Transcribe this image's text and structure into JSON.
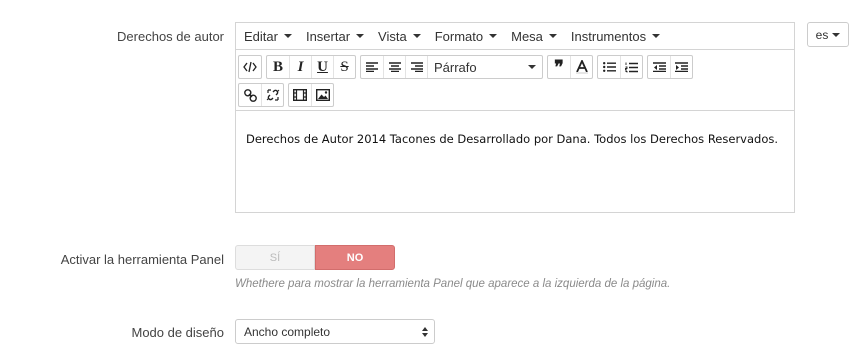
{
  "copyright": {
    "label": "Derechos de autor",
    "menus": [
      "Editar",
      "Insertar",
      "Vista",
      "Formato",
      "Mesa",
      "Instrumentos"
    ],
    "format_select": "Párrafo",
    "content": "Derechos de Autor 2014 Tacones de Desarrollado por Dana. Todos los Derechos Reservados.",
    "language_button": "es"
  },
  "panel_tool": {
    "label": "Activar la herramienta Panel",
    "yes_label": "SÍ",
    "no_label": "NO",
    "help_text": "Whethere para mostrar la herramienta Panel que aparece a la izquierda de la página."
  },
  "design_mode": {
    "label": "Modo de diseño",
    "selected": "Ancho completo"
  }
}
